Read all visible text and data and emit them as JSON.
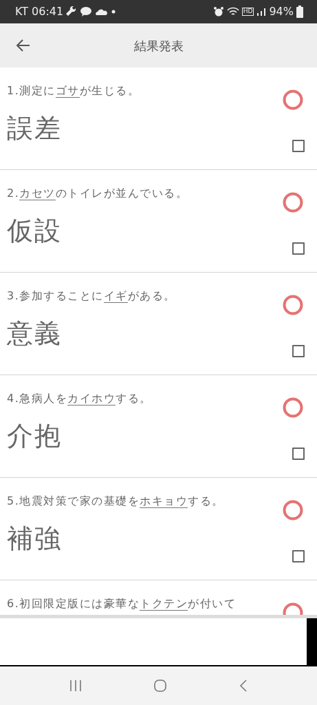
{
  "status_bar": {
    "carrier_time": "KT 06:41",
    "hd": "HD",
    "battery": "94%"
  },
  "header": {
    "title": "結果発表"
  },
  "items": [
    {
      "kind": "correct",
      "before": "1.測定に",
      "reading": "ゴサ",
      "after": "が生じる。",
      "kanji": "誤差",
      "checked": false
    },
    {
      "kind": "correct",
      "before": "2.",
      "reading": "カセツ",
      "after": "のトイレが並んでいる。",
      "kanji": "仮設",
      "checked": false
    },
    {
      "kind": "correct",
      "before": "3.参加することに",
      "reading": "イギ",
      "after": "がある。",
      "kanji": "意義",
      "checked": false
    },
    {
      "kind": "correct",
      "before": "4.急病人を",
      "reading": "カイホウ",
      "after": "する。",
      "kanji": "介抱",
      "checked": false
    },
    {
      "kind": "correct",
      "before": "5.地震対策で家の基礎を",
      "reading": "ホキョウ",
      "after": "する。",
      "kanji": "補強",
      "checked": false
    },
    {
      "kind": "correct",
      "before": "6.初回限定版には豪華な",
      "reading": "トクテン",
      "after": "が付いて"
    }
  ]
}
